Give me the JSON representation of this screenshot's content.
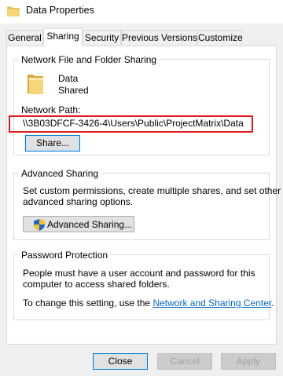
{
  "window": {
    "title": "Data Properties",
    "title_icon": "folder-icon"
  },
  "tabs": [
    {
      "label": "General"
    },
    {
      "label": "Sharing",
      "active": true
    },
    {
      "label": "Security"
    },
    {
      "label": "Previous Versions"
    },
    {
      "label": "Customize"
    }
  ],
  "network_sharing": {
    "group_label": "Network File and Folder Sharing",
    "folder_icon": "folder-icon",
    "folder_name": "Data",
    "status": "Shared",
    "path_label": "Network Path:",
    "path_value": "\\\\3B03DFCF-3426-4\\Users\\Public\\ProjectMatrix\\Data",
    "highlight_color": "#e01b1b",
    "share_button": "Share..."
  },
  "advanced_sharing": {
    "group_label": "Advanced Sharing",
    "description_line1": "Set custom permissions, create multiple shares, and set other",
    "description_line2": "advanced sharing options.",
    "button_label": "Advanced Sharing...",
    "button_icon": "shield-icon"
  },
  "password_protection": {
    "group_label": "Password Protection",
    "line1": "People must have a user account and password for this",
    "line2": "computer to access shared folders.",
    "change_prefix": "To change this setting, use the",
    "link_text": "Network and Sharing Center",
    "change_suffix": "."
  },
  "footer": {
    "close": "Close",
    "cancel": "Cancel",
    "apply": "Apply"
  },
  "colors": {
    "accent": "#0078d7",
    "link": "#0066cc",
    "folder": "#e8c15c"
  }
}
